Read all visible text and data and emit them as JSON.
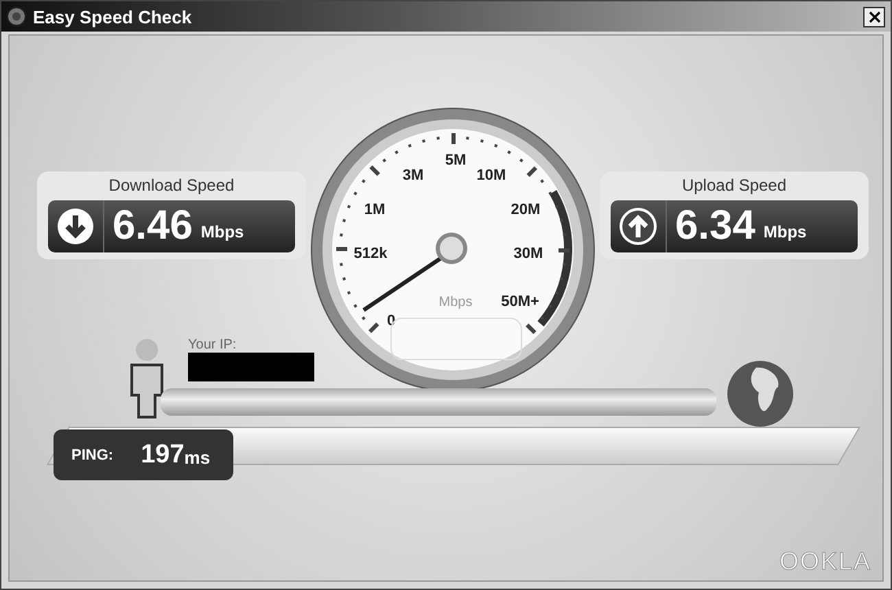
{
  "window": {
    "title": "Easy Speed Check"
  },
  "download": {
    "label": "Download Speed",
    "value": "6.46",
    "unit": "Mbps"
  },
  "upload": {
    "label": "Upload Speed",
    "value": "6.34",
    "unit": "Mbps"
  },
  "gauge": {
    "scale_labels": [
      "5M",
      "3M",
      "10M",
      "1M",
      "20M",
      "512k",
      "30M",
      "0",
      "50M+"
    ],
    "unit": "Mbps"
  },
  "ip": {
    "label": "Your IP:"
  },
  "ping": {
    "label": "PING:",
    "value": "197",
    "unit": "ms"
  },
  "logo": "OOKLA"
}
